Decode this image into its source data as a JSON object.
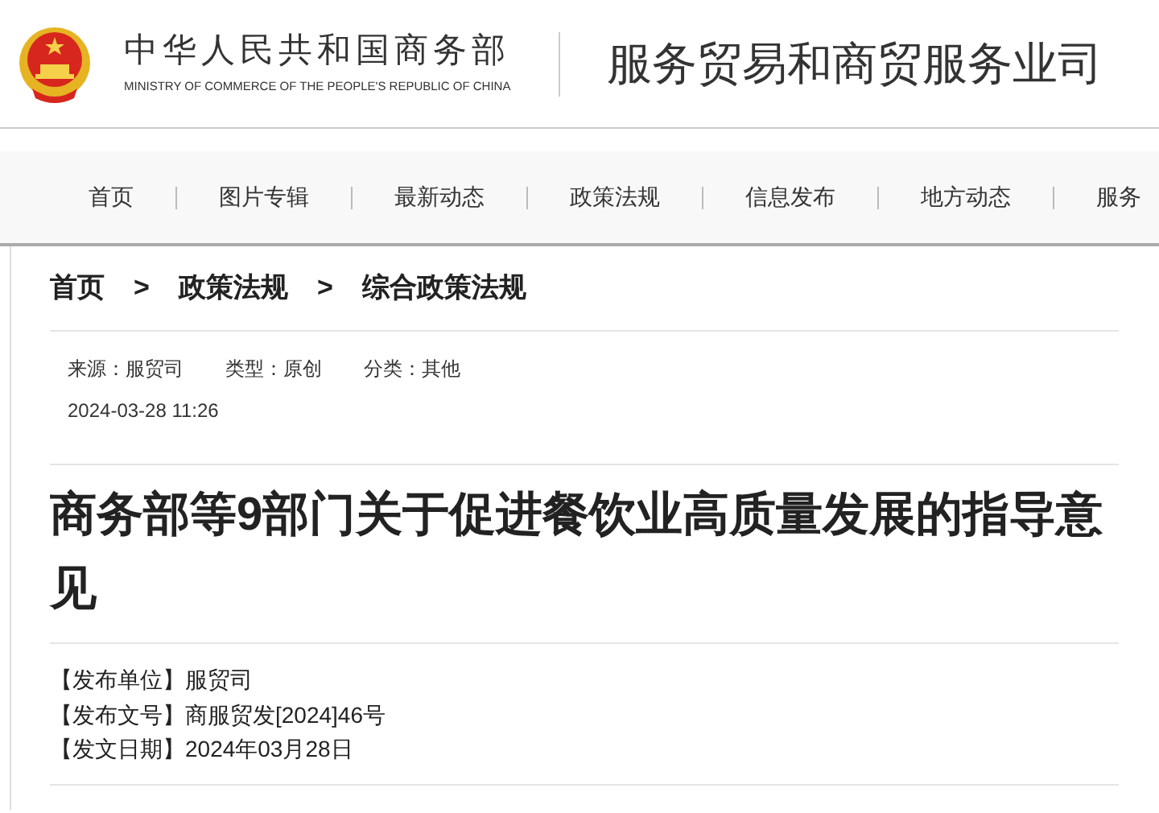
{
  "header": {
    "title": "中华人民共和国商务部",
    "subtitle": "MINISTRY OF COMMERCE OF THE PEOPLE'S REPUBLIC OF CHINA",
    "department": "服务贸易和商贸服务业司"
  },
  "nav": [
    {
      "label": "首页"
    },
    {
      "label": "图片专辑"
    },
    {
      "label": "最新动态"
    },
    {
      "label": "政策法规"
    },
    {
      "label": "信息发布"
    },
    {
      "label": "地方动态"
    },
    {
      "label": "服务"
    }
  ],
  "breadcrumb": [
    {
      "label": "首页"
    },
    {
      "label": "政策法规"
    },
    {
      "label": "综合政策法规"
    }
  ],
  "breadcrumb_separator": ">",
  "meta": [
    "来源：服贸司",
    "类型：原创",
    "分类：其他"
  ],
  "date": "2024-03-28 11:26",
  "article_title": "商务部等9部门关于促进餐饮业高质量发展的指导意见",
  "info": [
    {
      "label": "【发布单位】",
      "value": "服贸司"
    },
    {
      "label": "【发布文号】",
      "value": "商服贸发[2024]46号"
    },
    {
      "label": "【发文日期】",
      "value": "2024年03月28日"
    }
  ]
}
